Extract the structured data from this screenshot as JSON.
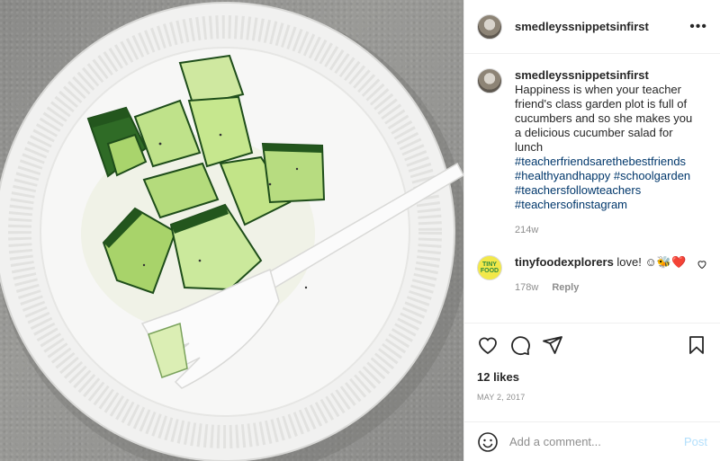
{
  "post": {
    "username": "smedleyssnippetsinfirst",
    "more_label": "•••"
  },
  "caption": {
    "username": "smedleyssnippetsinfirst",
    "text": "Happiness is when your teacher friend's class garden plot is full of cucumbers and so she makes you a delicious cucumber salad for lunch",
    "hashtags": [
      "#teacherfriendsarethebestfriends",
      "#healthyandhappy #schoolgarden",
      "#teachersfollowteachers",
      "#teachersofinstagram"
    ],
    "age": "214w"
  },
  "reply": {
    "username": "tinyfoodexplorers",
    "text": "love! ☺🐝❤️",
    "avatar_text": "TINY FOOD",
    "age": "178w",
    "reply_label": "Reply"
  },
  "actions": {
    "likes": "12 likes",
    "date": "MAY 2, 2017"
  },
  "add_comment": {
    "placeholder": "Add a comment...",
    "post_label": "Post"
  },
  "icons": [
    "heart-icon",
    "comment-icon",
    "share-icon",
    "bookmark-icon",
    "emoji-icon",
    "more-icon"
  ],
  "colors": {
    "hashtag": "#00376b",
    "muted": "#8e8e8e",
    "post_button": "#b2dffc"
  }
}
